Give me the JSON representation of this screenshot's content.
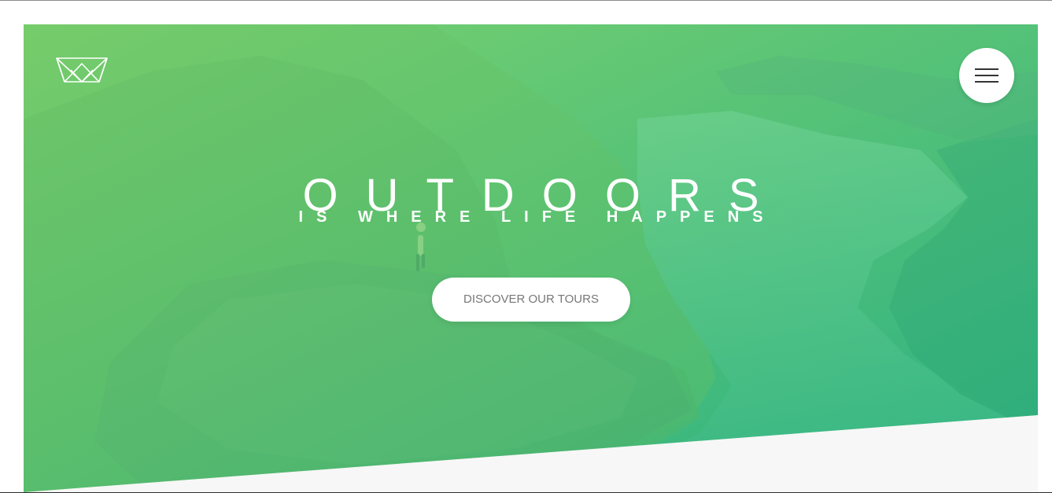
{
  "hero": {
    "title": "OUTDOORS",
    "subtitle": "IS WHERE LIFE HAPPENS",
    "cta_label": "DISCOVER OUR TOURS"
  },
  "logo": {
    "icon": "crown-outline-icon"
  },
  "menu": {
    "icon": "hamburger-menu-icon"
  },
  "colors": {
    "gradient_start": "#7ed56f",
    "gradient_end": "#28b485",
    "button_text": "#777777",
    "text_light": "#ffffff"
  }
}
